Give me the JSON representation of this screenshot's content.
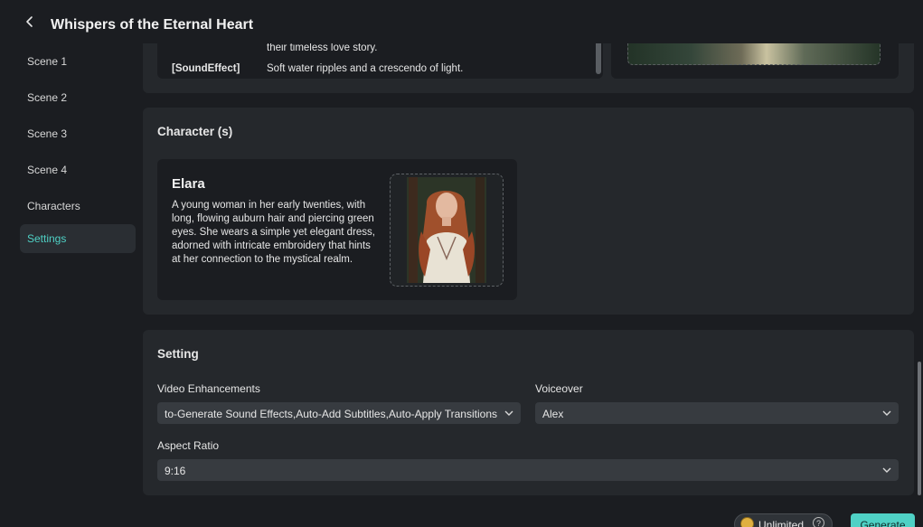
{
  "header": {
    "title": "Whispers of the Eternal Heart"
  },
  "sidebar": {
    "items": [
      {
        "label": "Scene 1"
      },
      {
        "label": "Scene 2"
      },
      {
        "label": "Scene 3"
      },
      {
        "label": "Scene 4"
      },
      {
        "label": "Characters"
      },
      {
        "label": "Settings",
        "active": true
      }
    ]
  },
  "scene_preview": {
    "line1_text": "their timeless love story.",
    "line2_tag": "[SoundEffect]",
    "line2_text": "Soft water ripples and a crescendo of light."
  },
  "characters": {
    "section_title": "Character (s)",
    "items": [
      {
        "name": "Elara",
        "description": "A young woman in her early twenties, with long, flowing auburn hair and piercing green eyes. She wears a simple yet elegant dress, adorned with intricate embroidery that hints at her connection to the mystical realm."
      }
    ]
  },
  "setting": {
    "section_title": "Setting",
    "video_enhancements": {
      "label": "Video Enhancements",
      "value": "to-Generate Sound Effects,Auto-Add Subtitles,Auto-Apply Transitions"
    },
    "voiceover": {
      "label": "Voiceover",
      "value": "Alex"
    },
    "aspect_ratio": {
      "label": "Aspect Ratio",
      "value": "9:16"
    }
  },
  "footer": {
    "plan_label": "Unlimited",
    "help_glyph": "?",
    "generate_label": "Generate"
  },
  "colors": {
    "accent": "#4fd1c5",
    "background": "#1b1d21",
    "panel": "#25282c",
    "select": "#373b40"
  }
}
